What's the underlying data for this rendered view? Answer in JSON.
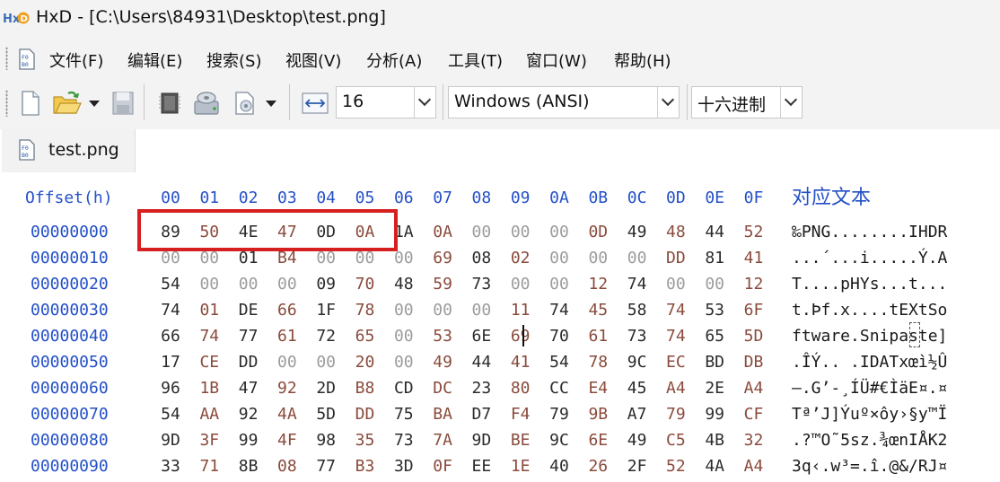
{
  "window": {
    "title": "HxD - [C:\\Users\\84931\\Desktop\\test.png]"
  },
  "menu": {
    "items": [
      "文件(F)",
      "编辑(E)",
      "搜索(S)",
      "视图(V)",
      "分析(A)",
      "工具(T)",
      "窗口(W)",
      "帮助(H)"
    ]
  },
  "toolbar": {
    "bytes_per_row": "16",
    "charset": "Windows (ANSI)",
    "offset_base": "十六进制"
  },
  "tab": {
    "label": "test.png"
  },
  "editor": {
    "offset_header": "Offset(h)",
    "column_headers": [
      "00",
      "01",
      "02",
      "03",
      "04",
      "05",
      "06",
      "07",
      "08",
      "09",
      "0A",
      "0B",
      "0C",
      "0D",
      "0E",
      "0F"
    ],
    "text_header": "对应文本",
    "rows": [
      {
        "offset": "00000000",
        "bytes": [
          "89",
          "50",
          "4E",
          "47",
          "0D",
          "0A",
          "1A",
          "0A",
          "00",
          "00",
          "00",
          "0D",
          "49",
          "48",
          "44",
          "52"
        ],
        "text": "‰PNG........IHDR"
      },
      {
        "offset": "00000010",
        "bytes": [
          "00",
          "00",
          "01",
          "B4",
          "00",
          "00",
          "00",
          "69",
          "08",
          "02",
          "00",
          "00",
          "00",
          "DD",
          "81",
          "41"
        ],
        "text": "...´...i.....Ý.A"
      },
      {
        "offset": "00000020",
        "bytes": [
          "54",
          "00",
          "00",
          "00",
          "09",
          "70",
          "48",
          "59",
          "73",
          "00",
          "00",
          "12",
          "74",
          "00",
          "00",
          "12"
        ],
        "text": "T....pHYs...t..."
      },
      {
        "offset": "00000030",
        "bytes": [
          "74",
          "01",
          "DE",
          "66",
          "1F",
          "78",
          "00",
          "00",
          "00",
          "11",
          "74",
          "45",
          "58",
          "74",
          "53",
          "6F"
        ],
        "text": "t.Þf.x....tEXtSo"
      },
      {
        "offset": "00000040",
        "bytes": [
          "66",
          "74",
          "77",
          "61",
          "72",
          "65",
          "00",
          "53",
          "6E",
          "69",
          "70",
          "61",
          "73",
          "74",
          "65",
          "5D"
        ],
        "text": "ftware.Snipaste]"
      },
      {
        "offset": "00000050",
        "bytes": [
          "17",
          "CE",
          "DD",
          "00",
          "00",
          "20",
          "00",
          "49",
          "44",
          "41",
          "54",
          "78",
          "9C",
          "EC",
          "BD",
          "DB"
        ],
        "text": ".ÎÝ.. .IDATxœì½Û"
      },
      {
        "offset": "00000060",
        "bytes": [
          "96",
          "1B",
          "47",
          "92",
          "2D",
          "B8",
          "CD",
          "DC",
          "23",
          "80",
          "CC",
          "E4",
          "45",
          "A4",
          "2E",
          "A4"
        ],
        "text": "–.G’-¸ÍÜ#€ÌäE¤.¤"
      },
      {
        "offset": "00000070",
        "bytes": [
          "54",
          "AA",
          "92",
          "4A",
          "5D",
          "DD",
          "75",
          "BA",
          "D7",
          "F4",
          "79",
          "9B",
          "A7",
          "79",
          "99",
          "CF"
        ],
        "text": "Tª’J]Ýuº×ôy›§y™Ï"
      },
      {
        "offset": "00000080",
        "bytes": [
          "9D",
          "3F",
          "99",
          "4F",
          "98",
          "35",
          "73",
          "7A",
          "9D",
          "BE",
          "9C",
          "6E",
          "49",
          "C5",
          "4B",
          "32"
        ],
        "text": ".?™O˜5sz.¾œnIÅK2"
      },
      {
        "offset": "00000090",
        "bytes": [
          "33",
          "71",
          "8B",
          "08",
          "77",
          "B3",
          "3D",
          "0F",
          "EE",
          "1E",
          "40",
          "26",
          "2F",
          "52",
          "4A",
          "A4"
        ],
        "text": "3q‹.w³=.î.@&/RJ¤"
      }
    ]
  },
  "colors": {
    "header_blue": "#2450c8",
    "byte_dark": "#2b2b2b",
    "byte_brown": "#8a4b3c",
    "byte_zero_gray": "#9c9c9c",
    "highlight_red": "#d62020"
  }
}
